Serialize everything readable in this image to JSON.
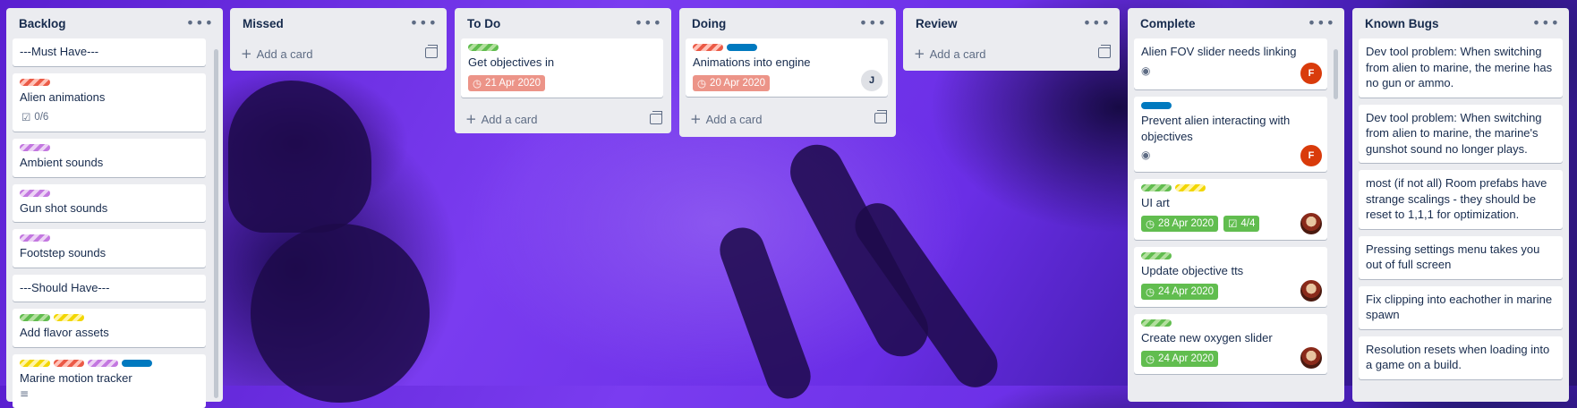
{
  "lists": [
    {
      "title": "Backlog",
      "cards": [
        {
          "title": "---Must Have---"
        },
        {
          "title": "Alien animations",
          "labels": [
            "red"
          ],
          "checklist": "0/6"
        },
        {
          "title": "Ambient sounds",
          "labels": [
            "purple"
          ]
        },
        {
          "title": "Gun shot sounds",
          "labels": [
            "purple"
          ]
        },
        {
          "title": "Footstep sounds",
          "labels": [
            "purple"
          ]
        },
        {
          "title": "---Should Have---"
        },
        {
          "title": "Add flavor assets",
          "labels": [
            "green",
            "yellow"
          ]
        },
        {
          "title": "Marine motion tracker",
          "labels": [
            "yellow",
            "red",
            "purple",
            "blue"
          ]
        }
      ]
    },
    {
      "title": "Missed",
      "add_label": "Add a card"
    },
    {
      "title": "To Do",
      "cards": [
        {
          "title": "Get objectives in",
          "labels": [
            "green"
          ],
          "due": "21 Apr 2020",
          "due_state": "overdue"
        }
      ],
      "add_label": "Add a card"
    },
    {
      "title": "Doing",
      "cards": [
        {
          "title": "Animations into engine",
          "labels": [
            "red",
            "blue"
          ],
          "due": "20 Apr 2020",
          "due_state": "overdue",
          "member": "J"
        }
      ],
      "add_label": "Add a card"
    },
    {
      "title": "Review",
      "add_label": "Add a card"
    },
    {
      "title": "Complete",
      "cards": [
        {
          "title": "Alien FOV slider needs linking",
          "member": "F"
        },
        {
          "title": "Prevent alien interacting with objectives",
          "labels": [
            "blue"
          ],
          "member": "F"
        },
        {
          "title": "UI art",
          "labels": [
            "green",
            "yellow"
          ],
          "due": "28 Apr 2020",
          "checklist": "4/4"
        },
        {
          "title": "Update objective tts",
          "labels": [
            "green"
          ],
          "due": "24 Apr 2020"
        },
        {
          "title": "Create new oxygen slider",
          "labels": [
            "green"
          ],
          "due": "24 Apr 2020"
        }
      ]
    },
    {
      "title": "Known Bugs",
      "cards": [
        {
          "title": "Dev tool problem: When switching from alien to marine, the merine has no gun or ammo."
        },
        {
          "title": "Dev tool problem: When switching from alien to marine, the marine's gunshot sound no longer plays."
        },
        {
          "title": "most (if not all) Room prefabs have strange scalings - they should be reset to 1,1,1 for optimization."
        },
        {
          "title": "Pressing settings menu takes you out of full screen"
        },
        {
          "title": "Fix clipping into eachother in marine spawn"
        },
        {
          "title": "Resolution resets when loading into a game on a build."
        }
      ]
    }
  ],
  "icons": {
    "menu": "more-icon",
    "add": "plus-icon",
    "template": "template-icon",
    "watch": "eye-icon",
    "checklist": "checklist-icon",
    "clock": "clock-icon",
    "description": "description-icon"
  }
}
